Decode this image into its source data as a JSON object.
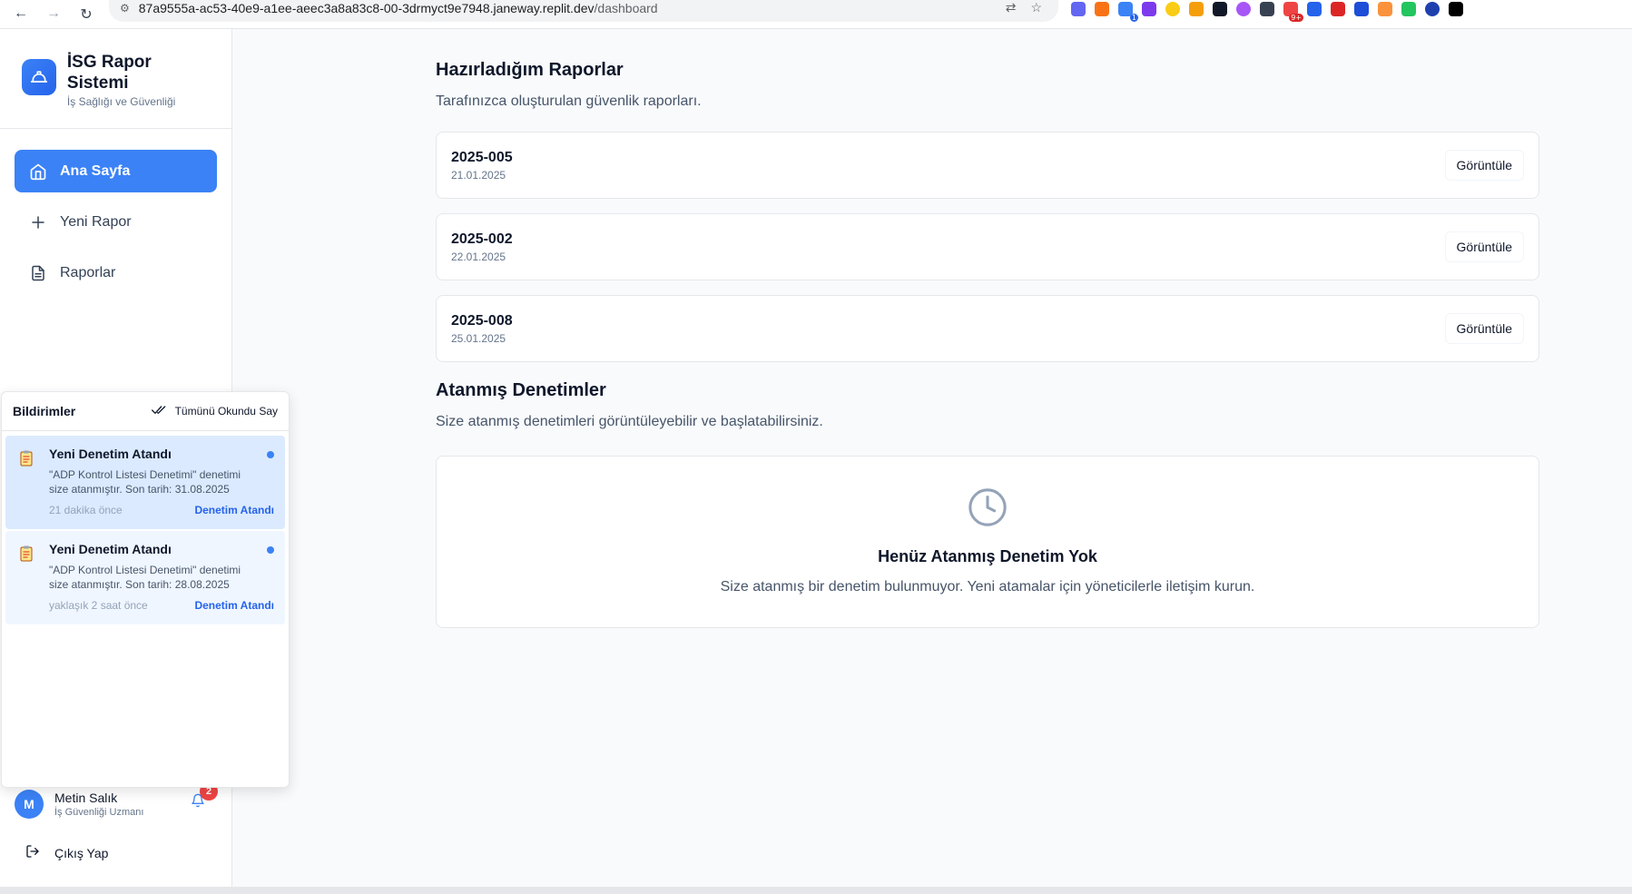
{
  "browser": {
    "url_host": "87a9555a-ac53-40e9-a1ee-aeec3a8a83c8-00-3drmyct9e7948.janeway.replit.dev",
    "url_path": "/dashboard",
    "extension_badges": [
      "1",
      "9+"
    ]
  },
  "brand": {
    "title": "İSG Rapor Sistemi",
    "subtitle": "İş Sağlığı ve Güvenliği"
  },
  "nav": {
    "items": [
      {
        "label": "Ana Sayfa",
        "icon": "home-icon",
        "active": true
      },
      {
        "label": "Yeni Rapor",
        "icon": "plus-icon",
        "active": false
      },
      {
        "label": "Raporlar",
        "icon": "document-icon",
        "active": false
      }
    ]
  },
  "notifications": {
    "title": "Bildirimler",
    "mark_all_label": "Tümünü Okundu Say",
    "items": [
      {
        "title": "Yeni Denetim Atandı",
        "message": "\"ADP Kontrol Listesi Denetimi\" denetimi size atanmıştır. Son tarih: 31.08.2025",
        "time": "21 dakika önce",
        "tag": "Denetim Atandı"
      },
      {
        "title": "Yeni Denetim Atandı",
        "message": "\"ADP Kontrol Listesi Denetimi\" denetimi size atanmıştır. Son tarih: 28.08.2025",
        "time": "yaklaşık 2 saat önce",
        "tag": "Denetim Atandı"
      }
    ]
  },
  "user": {
    "initial": "M",
    "name": "Metin Salık",
    "role": "İş Güvenliği Uzmanı",
    "unread_count": "2",
    "logout_label": "Çıkış Yap"
  },
  "reports_section": {
    "title": "Hazırladığım Raporlar",
    "description": "Tarafınızca oluşturulan güvenlik raporları.",
    "view_label": "Görüntüle",
    "items": [
      {
        "id": "2025-005",
        "date": "21.01.2025"
      },
      {
        "id": "2025-002",
        "date": "22.01.2025"
      },
      {
        "id": "2025-008",
        "date": "25.01.2025"
      }
    ]
  },
  "audits_section": {
    "title": "Atanmış Denetimler",
    "description": "Size atanmış denetimleri görüntüleyebilir ve başlatabilirsiniz.",
    "empty_title": "Henüz Atanmış Denetim Yok",
    "empty_description": "Size atanmış bir denetim bulunmuyor. Yeni atamalar için yöneticilerle iletişim kurun."
  },
  "colors": {
    "accent": "#3b82f6",
    "badge": "#ef4444",
    "unread_bg": "#dbeafe"
  }
}
